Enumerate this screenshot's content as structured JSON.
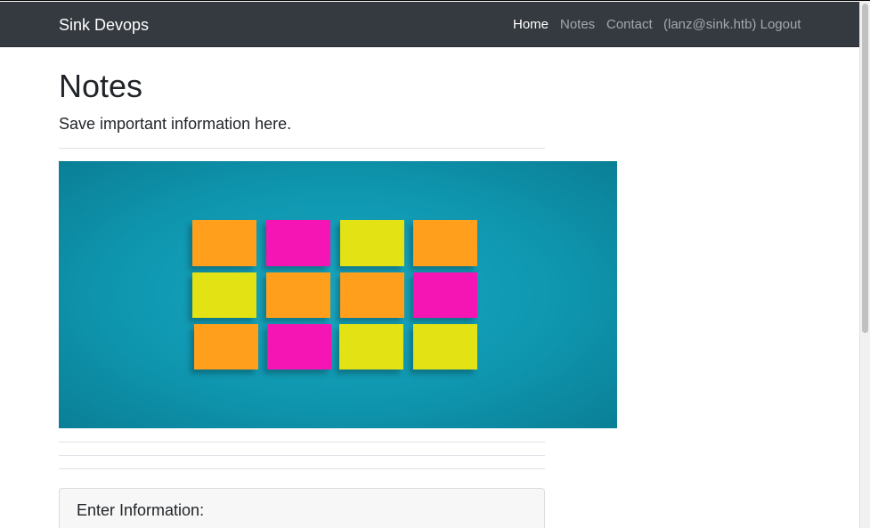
{
  "navbar": {
    "brand": "Sink Devops",
    "links": [
      {
        "label": "Home",
        "active": true
      },
      {
        "label": "Notes",
        "active": false
      },
      {
        "label": "Contact",
        "active": false
      },
      {
        "label": "(lanz@sink.htb) Logout",
        "active": false
      }
    ]
  },
  "main": {
    "title": "Notes",
    "lead": "Save important information here.",
    "hero_image": {
      "icon": "sticky-notes-image",
      "background": "#0f97b0",
      "note_colors": {
        "orange": "#ff9f1c",
        "pink": "#f515b4",
        "yellow": "#e2e214"
      }
    },
    "form_card": {
      "title": "Enter Information:"
    }
  },
  "colors": {
    "navbar_bg": "#343a40",
    "text": "#212529",
    "divider": "#dee2e6"
  }
}
